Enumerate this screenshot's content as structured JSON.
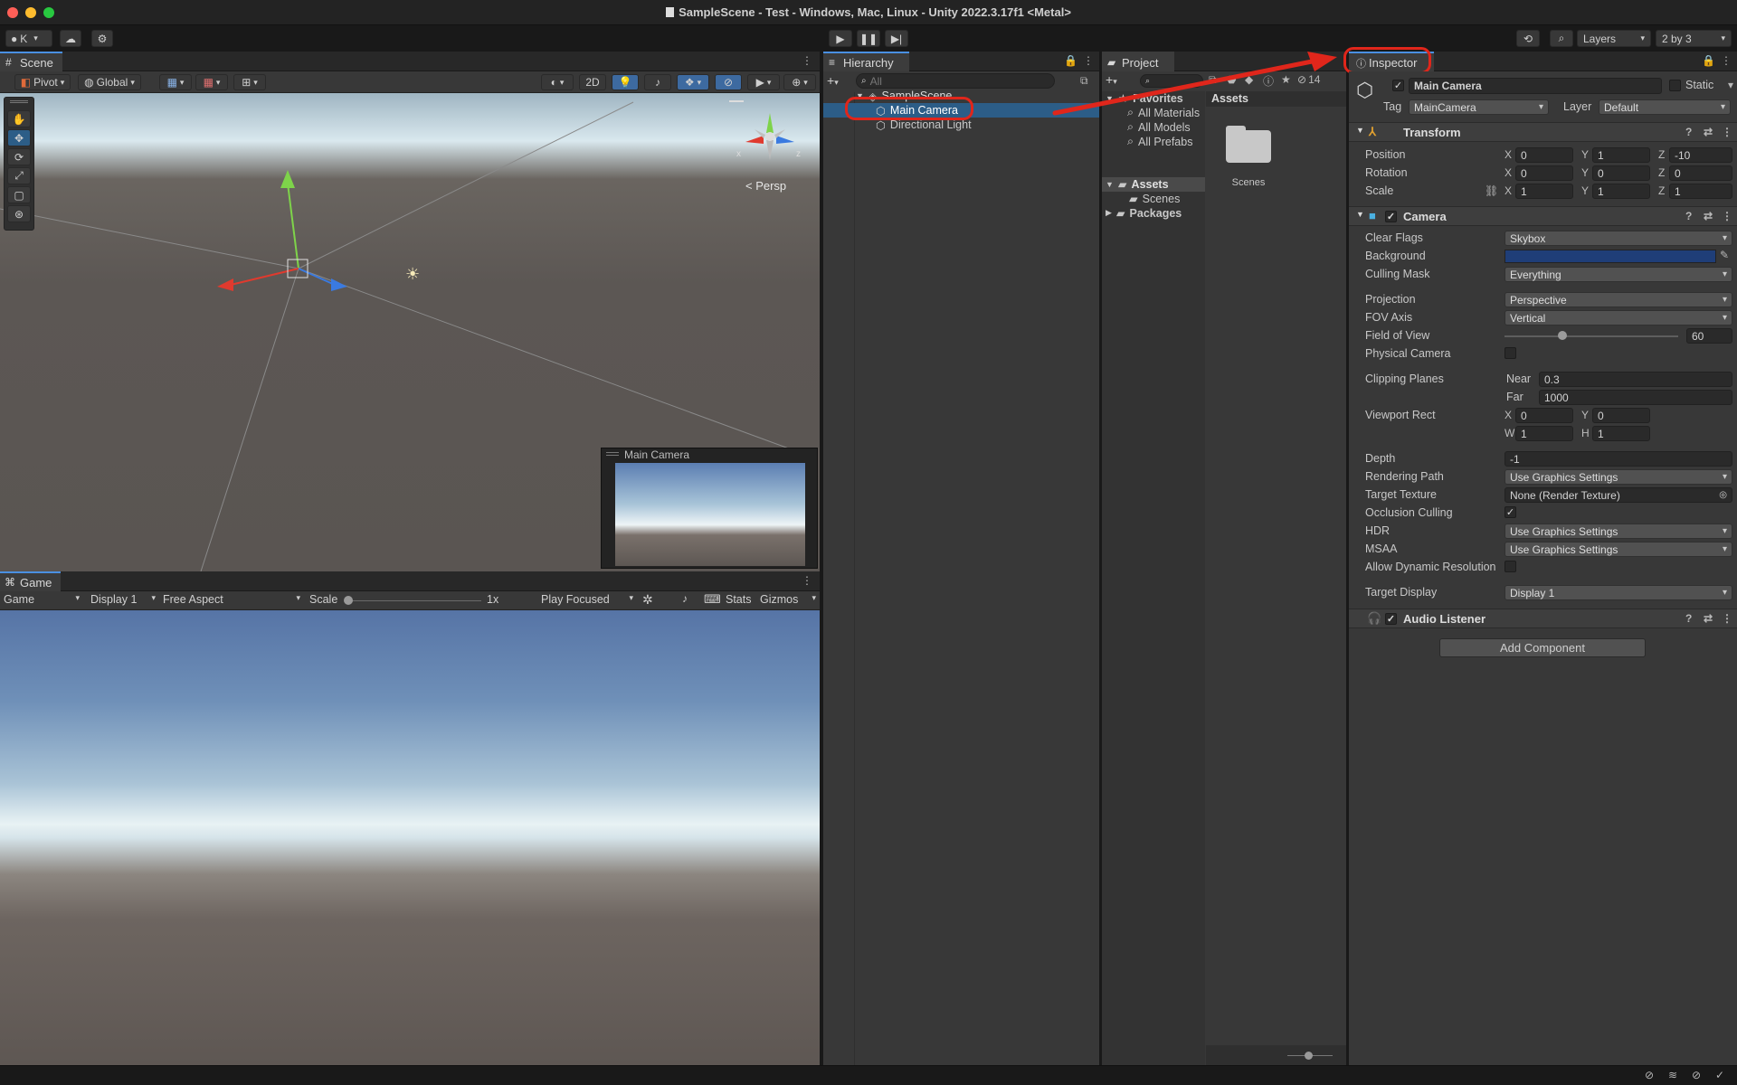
{
  "window": {
    "title": "SampleScene - Test - Windows, Mac, Linux - Unity 2022.3.17f1 <Metal>"
  },
  "toolbar": {
    "account": "K",
    "layers": "Layers",
    "layout": "2 by 3"
  },
  "scene": {
    "tab": "Scene",
    "pivot": "Pivot",
    "global": "Global",
    "mode_2d": "2D",
    "persp": "< Persp",
    "gizmo_x": "x",
    "gizmo_z": "z",
    "preview_title": "Main Camera"
  },
  "game": {
    "tab": "Game",
    "mode": "Game",
    "display": "Display 1",
    "aspect": "Free Aspect",
    "scale_label": "Scale",
    "scale_value": "1x",
    "play_mode": "Play Focused",
    "stats": "Stats",
    "gizmos": "Gizmos"
  },
  "hierarchy": {
    "tab": "Hierarchy",
    "search_placeholder": "All",
    "scene": "SampleScene",
    "items": [
      "Main Camera",
      "Directional Light"
    ]
  },
  "project": {
    "tab": "Project",
    "count": "14",
    "favorites": "Favorites",
    "fav_items": [
      "All Materials",
      "All Models",
      "All Prefabs"
    ],
    "assets": "Assets",
    "assets_child": "Scenes",
    "packages": "Packages",
    "breadcrumb": "Assets",
    "folder_name": "Scenes"
  },
  "inspector": {
    "tab": "Inspector",
    "object_name": "Main Camera",
    "static": "Static",
    "tag_label": "Tag",
    "tag_value": "MainCamera",
    "layer_label": "Layer",
    "layer_value": "Default",
    "transform": {
      "title": "Transform",
      "position_label": "Position",
      "position": [
        "0",
        "1",
        "-10"
      ],
      "rotation_label": "Rotation",
      "rotation": [
        "0",
        "0",
        "0"
      ],
      "scale_label": "Scale",
      "scale": [
        "1",
        "1",
        "1"
      ]
    },
    "camera": {
      "title": "Camera",
      "clear_flags_label": "Clear Flags",
      "clear_flags": "Skybox",
      "background_label": "Background",
      "background_color": "#1f3e78",
      "culling_mask_label": "Culling Mask",
      "culling_mask": "Everything",
      "projection_label": "Projection",
      "projection": "Perspective",
      "fov_axis_label": "FOV Axis",
      "fov_axis": "Vertical",
      "fov_label": "Field of View",
      "fov": "60",
      "fov_min": 1,
      "fov_max": 179,
      "physical_label": "Physical Camera",
      "clipping_label": "Clipping Planes",
      "near_label": "Near",
      "near": "0.3",
      "far_label": "Far",
      "far": "1000",
      "viewport_label": "Viewport Rect",
      "vx": "0",
      "vy": "0",
      "vw": "1",
      "vh": "1",
      "depth_label": "Depth",
      "depth": "-1",
      "rendering_path_label": "Rendering Path",
      "rendering_path": "Use Graphics Settings",
      "target_texture_label": "Target Texture",
      "target_texture": "None (Render Texture)",
      "occlusion_label": "Occlusion Culling",
      "hdr_label": "HDR",
      "hdr": "Use Graphics Settings",
      "msaa_label": "MSAA",
      "msaa": "Use Graphics Settings",
      "dynres_label": "Allow Dynamic Resolution",
      "target_display_label": "Target Display",
      "target_display": "Display 1"
    },
    "audio_listener": "Audio Listener",
    "add_component": "Add Component"
  },
  "axis_labels": {
    "x": "X",
    "y": "Y",
    "z": "Z",
    "w": "W",
    "h": "H"
  },
  "colors": {
    "accent": "#4a90e2",
    "selection": "#2c5d87",
    "annotation": "#e0261b"
  }
}
